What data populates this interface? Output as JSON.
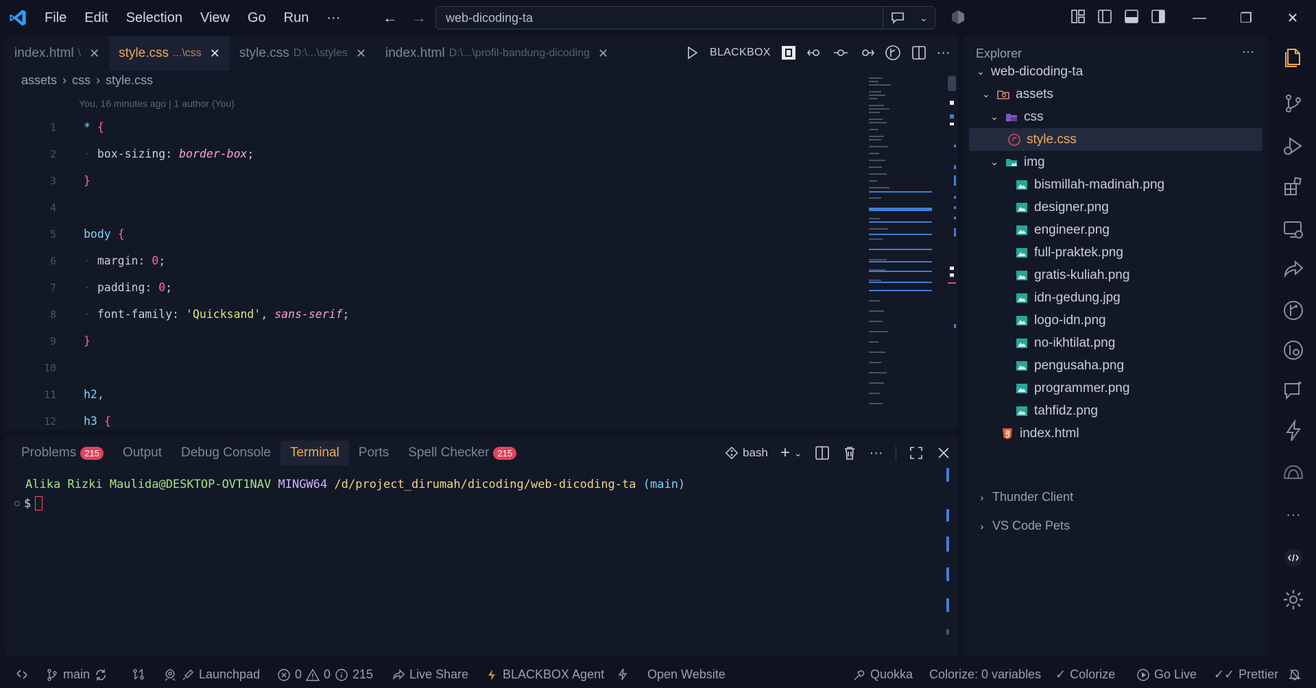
{
  "menu": [
    "File",
    "Edit",
    "Selection",
    "View",
    "Go",
    "Run",
    "···"
  ],
  "command_center": {
    "text": "web-dicoding-ta"
  },
  "tabs": [
    {
      "name": "index.html",
      "desc": "\\",
      "active": false
    },
    {
      "name": "style.css",
      "desc": "...\\css",
      "active": true
    },
    {
      "name": "style.css",
      "desc": "D:\\...\\styles",
      "active": false
    },
    {
      "name": "index.html",
      "desc": "D:\\...\\profil-bandung-dicoding",
      "active": false
    }
  ],
  "editor_actions": {
    "blackbox_label": "BLACKBOX"
  },
  "breadcrumb": [
    "assets",
    "css",
    "style.css"
  ],
  "blame": "You, 16 minutes ago | 1 author (You)",
  "code_lines": [
    "1",
    "2",
    "3",
    "4",
    "5",
    "6",
    "7",
    "8",
    "9",
    "10",
    "11",
    "12"
  ],
  "code": {
    "l1_sel": "*",
    "l2_prop": "box-sizing",
    "l2_val": "border-box",
    "l5_sel": "body",
    "l6_prop": "margin",
    "l6_val": "0",
    "l7_prop": "padding",
    "l7_val": "0",
    "l8_prop": "font-family",
    "l8_str": "'Quicksand'",
    "l8_val": "sans-serif",
    "l11_sel": "h2,",
    "l12_sel": "h3"
  },
  "panel": {
    "tabs": [
      {
        "label": "Problems",
        "badge": "215"
      },
      {
        "label": "Output",
        "badge": ""
      },
      {
        "label": "Debug Console",
        "badge": ""
      },
      {
        "label": "Terminal",
        "badge": "",
        "active": true
      },
      {
        "label": "Ports",
        "badge": ""
      },
      {
        "label": "Spell Checker",
        "badge": "215"
      }
    ],
    "shell": "bash"
  },
  "terminal": {
    "user": "Alika Rizki Maulida@DESKTOP-OVT1NAV",
    "host": "MINGW64",
    "path": "/d/project_dirumah/dicoding/web-dicoding-ta",
    "branch": "(main)",
    "prompt": "$"
  },
  "explorer": {
    "title": "Explorer",
    "root": "web-dicoding-ta",
    "folder_assets": "assets",
    "folder_css": "css",
    "file_css": "style.css",
    "folder_img": "img",
    "images": [
      "bismillah-madinah.png",
      "designer.png",
      "engineer.png",
      "full-praktek.png",
      "gratis-kuliah.png",
      "idn-gedung.jpg",
      "logo-idn.png",
      "no-ikhtilat.png",
      "pengusaha.png",
      "programmer.png",
      "tahfidz.png"
    ],
    "file_html": "index.html",
    "sections": [
      "Thunder Client",
      "VS Code Pets"
    ]
  },
  "status": {
    "branch": "main",
    "launchpad": "Launchpad",
    "errors": "0",
    "warnings": "0",
    "info": "215",
    "live_share": "Live Share",
    "blackbox_agent": "BLACKBOX Agent",
    "open_website": "Open Website",
    "quokka": "Quokka",
    "colorize_vars": "Colorize: 0 variables",
    "colorize": "Colorize",
    "go_live": "Go Live",
    "prettier": "Prettier"
  },
  "colors": {
    "accent": "#f1a85b",
    "badge": "#e2445c",
    "background": "#0f1320",
    "panel": "#131826"
  }
}
